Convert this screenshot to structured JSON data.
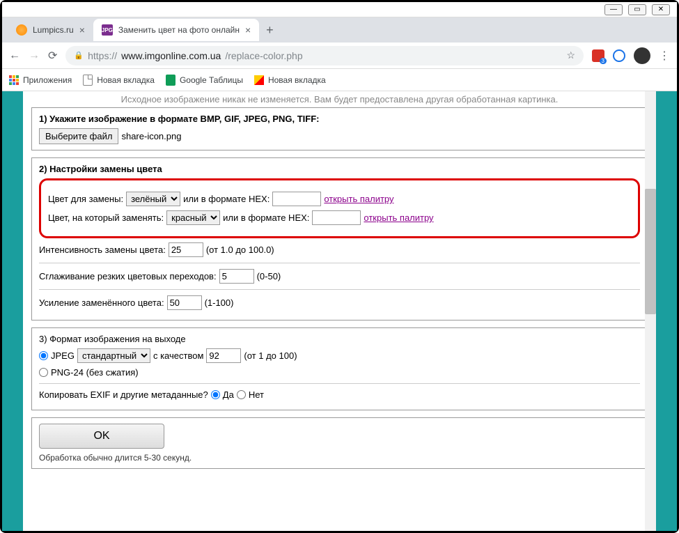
{
  "tabs": {
    "tab1": "Lumpics.ru",
    "tab2": "Заменить цвет на фото онлайн",
    "jpg": "JPG"
  },
  "url": {
    "scheme": "https://",
    "host": "www.imgonline.com.ua",
    "path": "/replace-color.php"
  },
  "bookmarks": {
    "apps": "Приложения",
    "newtab1": "Новая вкладка",
    "sheets": "Google Таблицы",
    "newtab2": "Новая вкладка"
  },
  "cutoff": "Исходное изображение никак не изменяется. Вам будет предоставлена другая обработанная картинка.",
  "s1": {
    "title": "1) Укажите изображение в формате BMP, GIF, JPEG, PNG, TIFF:",
    "btn": "Выберите файл",
    "file": "share-icon.png"
  },
  "s2": {
    "title": "2) Настройки замены цвета",
    "r1_label": "Цвет для замены:",
    "r1_sel": "зелёный",
    "hex_label": "или в формате HEX:",
    "palette": "открыть палитру",
    "r2_label": "Цвет, на который заменять:",
    "r2_sel": "красный",
    "intensity_label": "Интенсивность замены цвета:",
    "intensity_val": "25",
    "intensity_range": "(от 1.0 до 100.0)",
    "smooth_label": "Сглаживание резких цветовых переходов:",
    "smooth_val": "5",
    "smooth_range": "(0-50)",
    "boost_label": "Усиление заменённого цвета:",
    "boost_val": "50",
    "boost_range": "(1-100)"
  },
  "s3": {
    "title": "3) Формат изображения на выходе",
    "jpeg": "JPEG",
    "jpeg_sel": "стандартный",
    "quality_label": "с качеством",
    "quality_val": "92",
    "quality_range": "(от 1 до 100)",
    "png": "PNG-24 (без сжатия)",
    "exif_label": "Копировать EXIF и другие метаданные?",
    "yes": "Да",
    "no": "Нет"
  },
  "ok": "OK",
  "note": "Обработка обычно длится 5-30 секунд."
}
